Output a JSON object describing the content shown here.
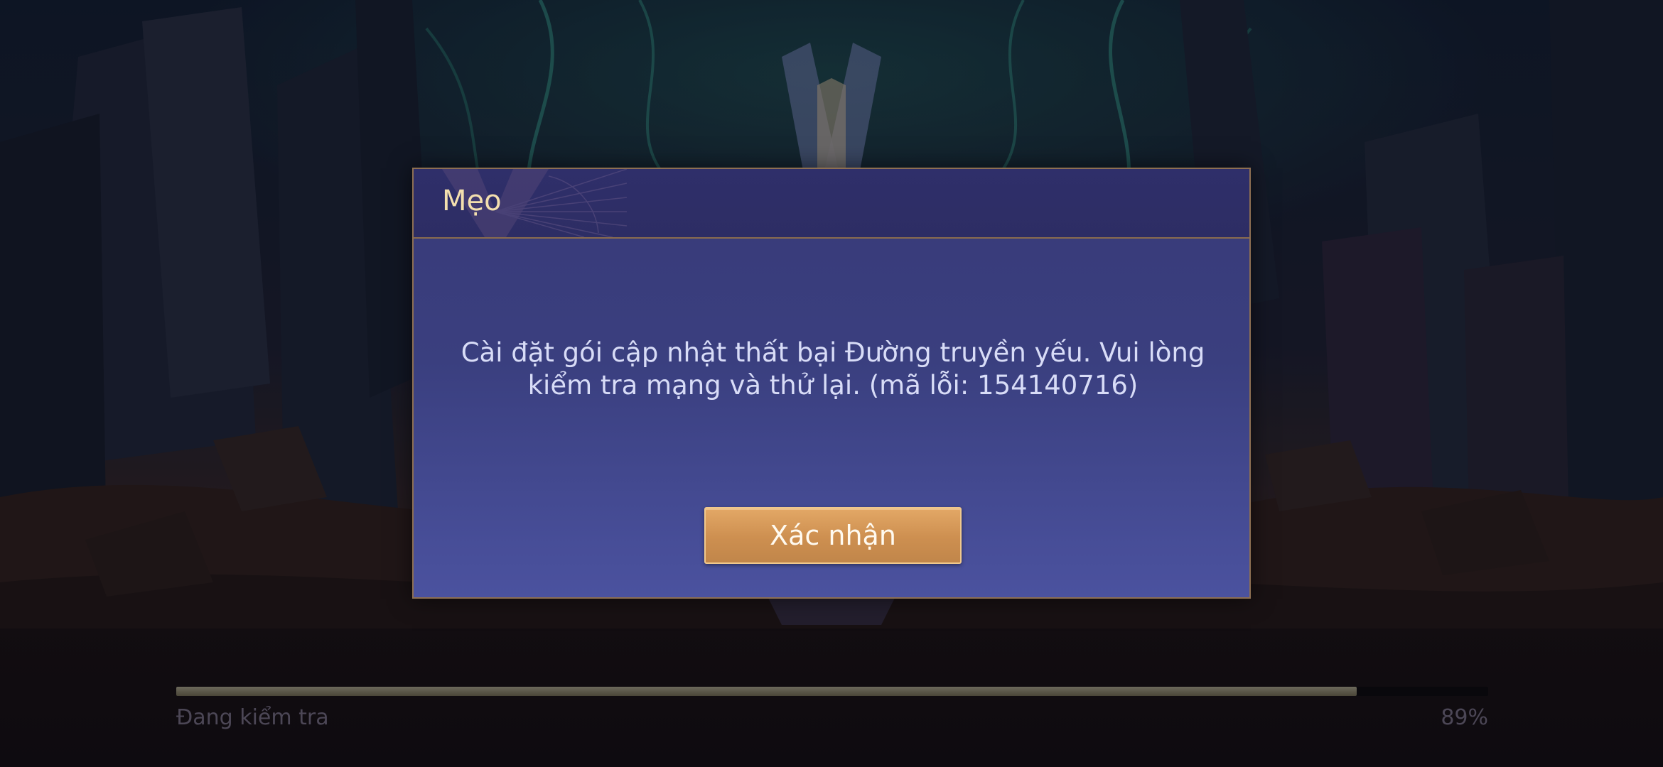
{
  "dialog": {
    "title": "Mẹo",
    "message": "Cài đặt gói cập nhật thất bại Đường truyền yếu. Vui lòng kiểm tra mạng và thử lại. (mã lỗi: 154140716)",
    "confirm_label": "Xác nhận"
  },
  "loading": {
    "status_text": "Đang kiểm tra",
    "percent_text": "89%",
    "progress": 0.9
  },
  "icons": {
    "header_emblem": "v-emblem-icon"
  },
  "colors": {
    "dialog_bg": "#3a3f7f",
    "dialog_border": "#8d6f52",
    "title": "#f3dfae",
    "message": "#d8dcf7",
    "button": "#cd8f50"
  }
}
